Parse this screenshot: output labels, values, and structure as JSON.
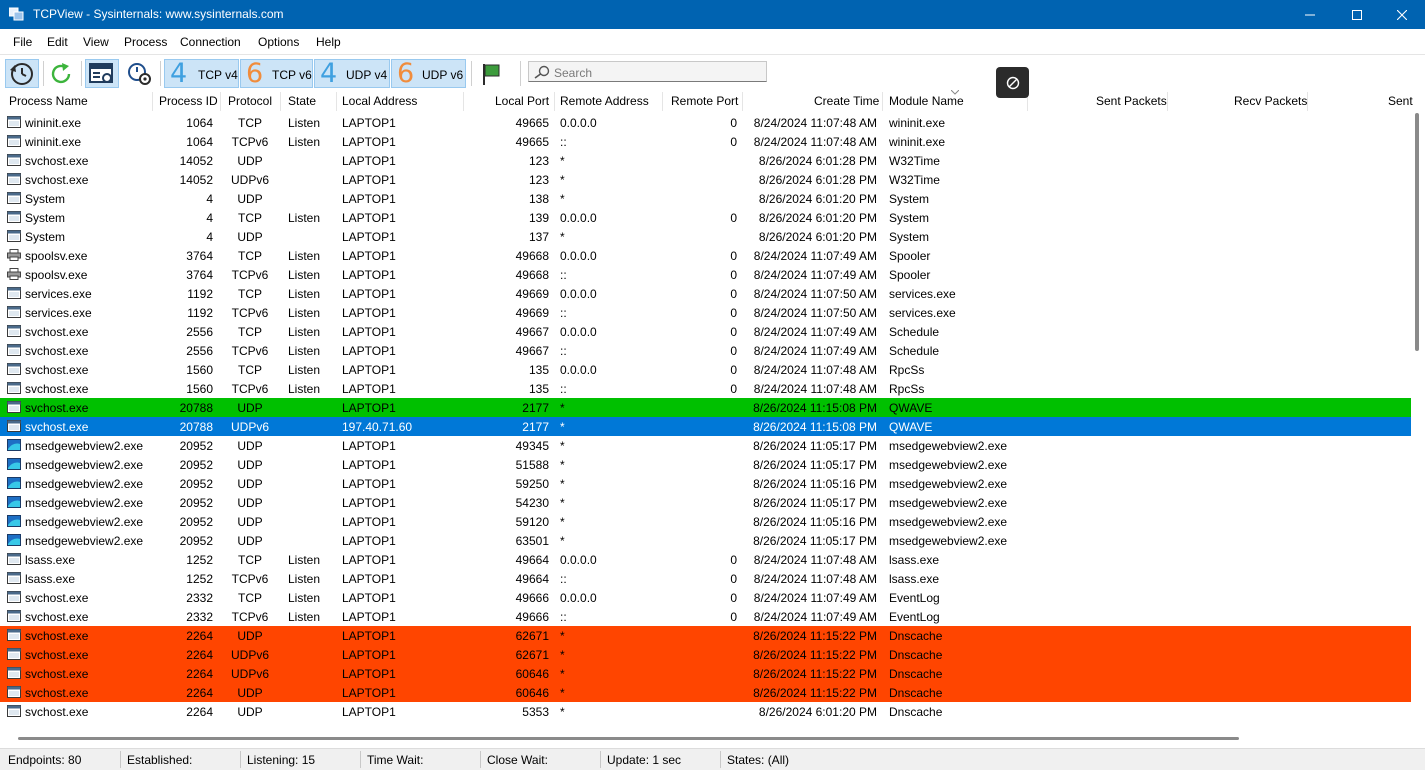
{
  "window": {
    "title": "TCPView - Sysinternals: www.sysinternals.com",
    "colors": {
      "titlebar": "#0063b1",
      "green_row": "#00c000",
      "blue_row": "#0078d7",
      "red_row": "#ff4500"
    }
  },
  "menu": [
    "File",
    "Edit",
    "View",
    "Process",
    "Connection",
    "Options",
    "Help"
  ],
  "toolbar": {
    "icons": [
      "refresh-interval-icon",
      "refresh-icon",
      "resolve-addresses-icon",
      "process-settings-icon",
      "flag-icon"
    ],
    "protocols": [
      {
        "num": "4",
        "label": "TCP v4"
      },
      {
        "num": "6",
        "label": "TCP v6"
      },
      {
        "num": "4",
        "label": "UDP v4"
      },
      {
        "num": "6",
        "label": "UDP v6"
      }
    ],
    "search_placeholder": "Search"
  },
  "columns": [
    "Process Name",
    "Process ID",
    "Protocol",
    "State",
    "Local Address",
    "Local Port",
    "Remote Address",
    "Remote Port",
    "Create Time",
    "Module Name",
    "Sent Packets",
    "Recv Packets",
    "Sent"
  ],
  "rows": [
    {
      "name": "wininit.exe",
      "pid": "1064",
      "proto": "TCP",
      "state": "Listen",
      "laddr": "LAPTOP1",
      "lport": "49665",
      "raddr": "0.0.0.0",
      "rport": "0",
      "time": "8/24/2024 11:07:48 AM",
      "module": "wininit.exe",
      "icon": "app-window-icon",
      "hl": ""
    },
    {
      "name": "wininit.exe",
      "pid": "1064",
      "proto": "TCPv6",
      "state": "Listen",
      "laddr": "LAPTOP1",
      "lport": "49665",
      "raddr": "::",
      "rport": "0",
      "time": "8/24/2024 11:07:48 AM",
      "module": "wininit.exe",
      "icon": "app-window-icon",
      "hl": ""
    },
    {
      "name": "svchost.exe",
      "pid": "14052",
      "proto": "UDP",
      "state": "",
      "laddr": "LAPTOP1",
      "lport": "123",
      "raddr": "*",
      "rport": "",
      "time": "8/26/2024 6:01:28 PM",
      "module": "W32Time",
      "icon": "app-window-icon",
      "hl": ""
    },
    {
      "name": "svchost.exe",
      "pid": "14052",
      "proto": "UDPv6",
      "state": "",
      "laddr": "LAPTOP1",
      "lport": "123",
      "raddr": "*",
      "rport": "",
      "time": "8/26/2024 6:01:28 PM",
      "module": "W32Time",
      "icon": "app-window-icon",
      "hl": ""
    },
    {
      "name": "System",
      "pid": "4",
      "proto": "UDP",
      "state": "",
      "laddr": "LAPTOP1",
      "lport": "138",
      "raddr": "*",
      "rport": "",
      "time": "8/26/2024 6:01:20 PM",
      "module": "System",
      "icon": "app-window-icon",
      "hl": ""
    },
    {
      "name": "System",
      "pid": "4",
      "proto": "TCP",
      "state": "Listen",
      "laddr": "LAPTOP1",
      "lport": "139",
      "raddr": "0.0.0.0",
      "rport": "0",
      "time": "8/26/2024 6:01:20 PM",
      "module": "System",
      "icon": "app-window-icon",
      "hl": ""
    },
    {
      "name": "System",
      "pid": "4",
      "proto": "UDP",
      "state": "",
      "laddr": "LAPTOP1",
      "lport": "137",
      "raddr": "*",
      "rport": "",
      "time": "8/26/2024 6:01:20 PM",
      "module": "System",
      "icon": "app-window-icon",
      "hl": ""
    },
    {
      "name": "spoolsv.exe",
      "pid": "3764",
      "proto": "TCP",
      "state": "Listen",
      "laddr": "LAPTOP1",
      "lport": "49668",
      "raddr": "0.0.0.0",
      "rport": "0",
      "time": "8/24/2024 11:07:49 AM",
      "module": "Spooler",
      "icon": "printer-icon",
      "hl": ""
    },
    {
      "name": "spoolsv.exe",
      "pid": "3764",
      "proto": "TCPv6",
      "state": "Listen",
      "laddr": "LAPTOP1",
      "lport": "49668",
      "raddr": "::",
      "rport": "0",
      "time": "8/24/2024 11:07:49 AM",
      "module": "Spooler",
      "icon": "printer-icon",
      "hl": ""
    },
    {
      "name": "services.exe",
      "pid": "1192",
      "proto": "TCP",
      "state": "Listen",
      "laddr": "LAPTOP1",
      "lport": "49669",
      "raddr": "0.0.0.0",
      "rport": "0",
      "time": "8/24/2024 11:07:50 AM",
      "module": "services.exe",
      "icon": "app-window-icon",
      "hl": ""
    },
    {
      "name": "services.exe",
      "pid": "1192",
      "proto": "TCPv6",
      "state": "Listen",
      "laddr": "LAPTOP1",
      "lport": "49669",
      "raddr": "::",
      "rport": "0",
      "time": "8/24/2024 11:07:50 AM",
      "module": "services.exe",
      "icon": "app-window-icon",
      "hl": ""
    },
    {
      "name": "svchost.exe",
      "pid": "2556",
      "proto": "TCP",
      "state": "Listen",
      "laddr": "LAPTOP1",
      "lport": "49667",
      "raddr": "0.0.0.0",
      "rport": "0",
      "time": "8/24/2024 11:07:49 AM",
      "module": "Schedule",
      "icon": "app-window-icon",
      "hl": ""
    },
    {
      "name": "svchost.exe",
      "pid": "2556",
      "proto": "TCPv6",
      "state": "Listen",
      "laddr": "LAPTOP1",
      "lport": "49667",
      "raddr": "::",
      "rport": "0",
      "time": "8/24/2024 11:07:49 AM",
      "module": "Schedule",
      "icon": "app-window-icon",
      "hl": ""
    },
    {
      "name": "svchost.exe",
      "pid": "1560",
      "proto": "TCP",
      "state": "Listen",
      "laddr": "LAPTOP1",
      "lport": "135",
      "raddr": "0.0.0.0",
      "rport": "0",
      "time": "8/24/2024 11:07:48 AM",
      "module": "RpcSs",
      "icon": "app-window-icon",
      "hl": ""
    },
    {
      "name": "svchost.exe",
      "pid": "1560",
      "proto": "TCPv6",
      "state": "Listen",
      "laddr": "LAPTOP1",
      "lport": "135",
      "raddr": "::",
      "rport": "0",
      "time": "8/24/2024 11:07:48 AM",
      "module": "RpcSs",
      "icon": "app-window-icon",
      "hl": ""
    },
    {
      "name": "svchost.exe",
      "pid": "20788",
      "proto": "UDP",
      "state": "",
      "laddr": "LAPTOP1",
      "lport": "2177",
      "raddr": "*",
      "rport": "",
      "time": "8/26/2024 11:15:08 PM",
      "module": "QWAVE",
      "icon": "app-window-icon",
      "hl": "green"
    },
    {
      "name": "svchost.exe",
      "pid": "20788",
      "proto": "UDPv6",
      "state": "",
      "laddr": "197.40.71.60",
      "lport": "2177",
      "raddr": "*",
      "rport": "",
      "time": "8/26/2024 11:15:08 PM",
      "module": "QWAVE",
      "icon": "app-window-icon",
      "hl": "blue"
    },
    {
      "name": "msedgewebview2.exe",
      "pid": "20952",
      "proto": "UDP",
      "state": "",
      "laddr": "LAPTOP1",
      "lport": "49345",
      "raddr": "*",
      "rport": "",
      "time": "8/26/2024 11:05:17 PM",
      "module": "msedgewebview2.exe",
      "icon": "edge-webview-icon",
      "hl": ""
    },
    {
      "name": "msedgewebview2.exe",
      "pid": "20952",
      "proto": "UDP",
      "state": "",
      "laddr": "LAPTOP1",
      "lport": "51588",
      "raddr": "*",
      "rport": "",
      "time": "8/26/2024 11:05:17 PM",
      "module": "msedgewebview2.exe",
      "icon": "edge-webview-icon",
      "hl": ""
    },
    {
      "name": "msedgewebview2.exe",
      "pid": "20952",
      "proto": "UDP",
      "state": "",
      "laddr": "LAPTOP1",
      "lport": "59250",
      "raddr": "*",
      "rport": "",
      "time": "8/26/2024 11:05:16 PM",
      "module": "msedgewebview2.exe",
      "icon": "edge-webview-icon",
      "hl": ""
    },
    {
      "name": "msedgewebview2.exe",
      "pid": "20952",
      "proto": "UDP",
      "state": "",
      "laddr": "LAPTOP1",
      "lport": "54230",
      "raddr": "*",
      "rport": "",
      "time": "8/26/2024 11:05:17 PM",
      "module": "msedgewebview2.exe",
      "icon": "edge-webview-icon",
      "hl": ""
    },
    {
      "name": "msedgewebview2.exe",
      "pid": "20952",
      "proto": "UDP",
      "state": "",
      "laddr": "LAPTOP1",
      "lport": "59120",
      "raddr": "*",
      "rport": "",
      "time": "8/26/2024 11:05:16 PM",
      "module": "msedgewebview2.exe",
      "icon": "edge-webview-icon",
      "hl": ""
    },
    {
      "name": "msedgewebview2.exe",
      "pid": "20952",
      "proto": "UDP",
      "state": "",
      "laddr": "LAPTOP1",
      "lport": "63501",
      "raddr": "*",
      "rport": "",
      "time": "8/26/2024 11:05:17 PM",
      "module": "msedgewebview2.exe",
      "icon": "edge-webview-icon",
      "hl": ""
    },
    {
      "name": "lsass.exe",
      "pid": "1252",
      "proto": "TCP",
      "state": "Listen",
      "laddr": "LAPTOP1",
      "lport": "49664",
      "raddr": "0.0.0.0",
      "rport": "0",
      "time": "8/24/2024 11:07:48 AM",
      "module": "lsass.exe",
      "icon": "app-window-icon",
      "hl": ""
    },
    {
      "name": "lsass.exe",
      "pid": "1252",
      "proto": "TCPv6",
      "state": "Listen",
      "laddr": "LAPTOP1",
      "lport": "49664",
      "raddr": "::",
      "rport": "0",
      "time": "8/24/2024 11:07:48 AM",
      "module": "lsass.exe",
      "icon": "app-window-icon",
      "hl": ""
    },
    {
      "name": "svchost.exe",
      "pid": "2332",
      "proto": "TCP",
      "state": "Listen",
      "laddr": "LAPTOP1",
      "lport": "49666",
      "raddr": "0.0.0.0",
      "rport": "0",
      "time": "8/24/2024 11:07:49 AM",
      "module": "EventLog",
      "icon": "app-window-icon",
      "hl": ""
    },
    {
      "name": "svchost.exe",
      "pid": "2332",
      "proto": "TCPv6",
      "state": "Listen",
      "laddr": "LAPTOP1",
      "lport": "49666",
      "raddr": "::",
      "rport": "0",
      "time": "8/24/2024 11:07:49 AM",
      "module": "EventLog",
      "icon": "app-window-icon",
      "hl": ""
    },
    {
      "name": "svchost.exe",
      "pid": "2264",
      "proto": "UDP",
      "state": "",
      "laddr": "LAPTOP1",
      "lport": "62671",
      "raddr": "*",
      "rport": "",
      "time": "8/26/2024 11:15:22 PM",
      "module": "Dnscache",
      "icon": "app-window-icon",
      "hl": "red"
    },
    {
      "name": "svchost.exe",
      "pid": "2264",
      "proto": "UDPv6",
      "state": "",
      "laddr": "LAPTOP1",
      "lport": "62671",
      "raddr": "*",
      "rport": "",
      "time": "8/26/2024 11:15:22 PM",
      "module": "Dnscache",
      "icon": "app-window-icon",
      "hl": "red"
    },
    {
      "name": "svchost.exe",
      "pid": "2264",
      "proto": "UDPv6",
      "state": "",
      "laddr": "LAPTOP1",
      "lport": "60646",
      "raddr": "*",
      "rport": "",
      "time": "8/26/2024 11:15:22 PM",
      "module": "Dnscache",
      "icon": "app-window-icon",
      "hl": "red"
    },
    {
      "name": "svchost.exe",
      "pid": "2264",
      "proto": "UDP",
      "state": "",
      "laddr": "LAPTOP1",
      "lport": "60646",
      "raddr": "*",
      "rport": "",
      "time": "8/26/2024 11:15:22 PM",
      "module": "Dnscache",
      "icon": "app-window-icon",
      "hl": "red"
    },
    {
      "name": "svchost.exe",
      "pid": "2264",
      "proto": "UDP",
      "state": "",
      "laddr": "LAPTOP1",
      "lport": "5353",
      "raddr": "*",
      "rport": "",
      "time": "8/26/2024 6:01:20 PM",
      "module": "Dnscache",
      "icon": "app-window-icon",
      "hl": ""
    }
  ],
  "status": [
    {
      "text": "Endpoints: 80"
    },
    {
      "text": "Established:"
    },
    {
      "text": "Listening: 15"
    },
    {
      "text": "Time Wait:"
    },
    {
      "text": "Close Wait:"
    },
    {
      "text": "Update: 1 sec"
    },
    {
      "text": "States: (All)"
    }
  ]
}
